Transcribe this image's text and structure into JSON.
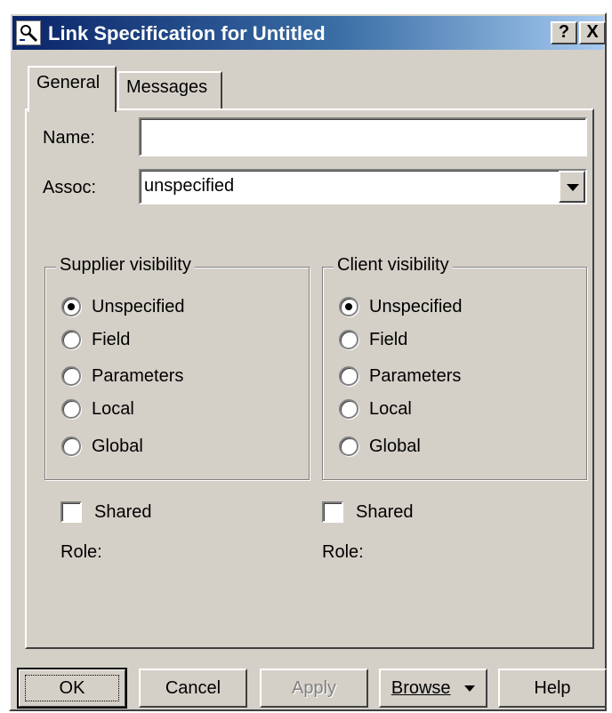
{
  "window": {
    "title": "Link Specification for Untitled",
    "help_label": "?",
    "close_label": "X"
  },
  "tabs": [
    {
      "label": "General",
      "selected": true
    },
    {
      "label": "Messages",
      "selected": false
    }
  ],
  "general": {
    "name_label": "Name:",
    "name_value": "",
    "assoc_label": "Assoc:",
    "assoc_value": "unspecified"
  },
  "supplier": {
    "title": "Supplier visibility",
    "options": [
      "Unspecified",
      "Field",
      "Parameters",
      "Local",
      "Global"
    ],
    "selected": "Unspecified",
    "shared_label": "Shared",
    "shared_checked": false,
    "role_label": "Role:"
  },
  "client": {
    "title": "Client visibility",
    "options": [
      "Unspecified",
      "Field",
      "Parameters",
      "Local",
      "Global"
    ],
    "selected": "Unspecified",
    "shared_label": "Shared",
    "shared_checked": false,
    "role_label": "Role:"
  },
  "buttons": {
    "ok": "OK",
    "cancel": "Cancel",
    "apply": "Apply",
    "browse": "Browse",
    "help": "Help"
  },
  "icons": {
    "app": "magnifier-icon",
    "dropdown": "chevron-down-icon",
    "browse_menu": "caret-down-icon"
  },
  "colors": {
    "titlebar_start": "#0a246a",
    "titlebar_end": "#a6caf0",
    "face": "#d4d0c8",
    "disabled_text": "#808080"
  }
}
